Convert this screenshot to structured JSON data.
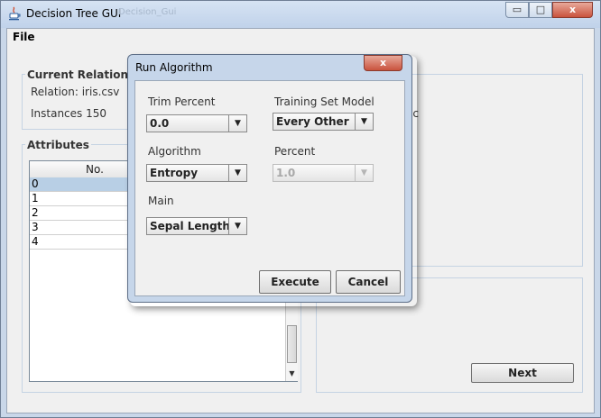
{
  "window": {
    "title": "Decision Tree GUI",
    "bg_title_ghost": "Decision_Gui",
    "min_glyph": "▭",
    "max_glyph": "□",
    "close_glyph": "x"
  },
  "menu": {
    "file": "File"
  },
  "current_relation": {
    "title": "Current Relation",
    "relation_label": "Relation:  iris.csv",
    "instances_label": "Instances 150"
  },
  "attributes": {
    "title": "Attributes",
    "column_header": "No.",
    "rows": [
      "0",
      "1",
      "2",
      "3",
      "4"
    ],
    "selected_index": 0
  },
  "right_panel": {
    "partial_text": "ic",
    "next_label": "Next"
  },
  "dialog": {
    "title": "Run Algorithm",
    "close_glyph": "x",
    "trim_percent_label": "Trim Percent",
    "trim_percent_value": "0.0",
    "training_set_model_label": "Training Set Model",
    "training_set_model_value": "Every Other",
    "algorithm_label": "Algorithm",
    "algorithm_value": "Entropy",
    "percent_label": "Percent",
    "percent_value": "1.0",
    "main_label": "Main",
    "main_value": "Sepal Length",
    "execute_label": "Execute",
    "cancel_label": "Cancel"
  },
  "icons": {
    "app": "java-cup-icon",
    "dropdown": "chevron-down-icon"
  }
}
